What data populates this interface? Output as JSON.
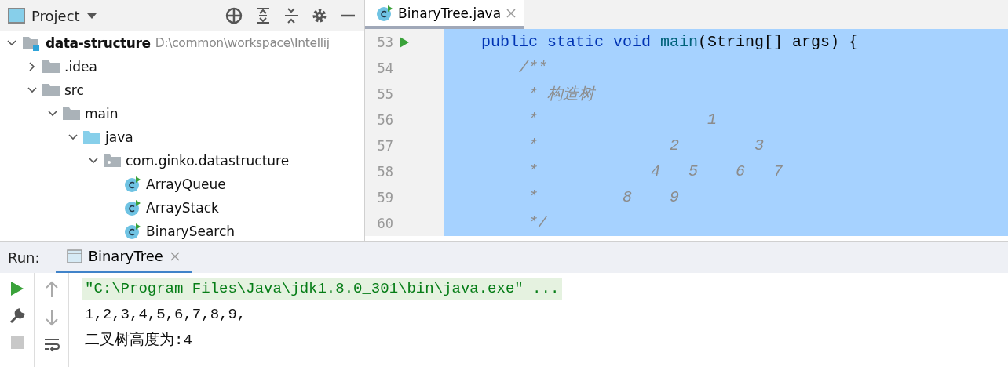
{
  "project_panel": {
    "title": "Project",
    "tree": [
      {
        "label": "data-structure",
        "hint": "D:\\common\\workspace\\Intellij",
        "kind": "module",
        "expanded": true,
        "children": [
          {
            "label": ".idea",
            "kind": "folder",
            "expanded": false
          },
          {
            "label": "src",
            "kind": "folder",
            "expanded": true,
            "children": [
              {
                "label": "main",
                "kind": "folder",
                "expanded": true,
                "children": [
                  {
                    "label": "java",
                    "kind": "source",
                    "expanded": true,
                    "children": [
                      {
                        "label": "com.ginko.datastructure",
                        "kind": "package",
                        "expanded": true,
                        "children": [
                          {
                            "label": "ArrayQueue",
                            "kind": "class"
                          },
                          {
                            "label": "ArrayStack",
                            "kind": "class"
                          },
                          {
                            "label": "BinarySearch",
                            "kind": "class"
                          }
                        ]
                      }
                    ]
                  }
                ]
              }
            ]
          }
        ]
      }
    ]
  },
  "editor": {
    "tabs": [
      {
        "label": "BinaryTree.java",
        "selected": true
      }
    ],
    "lines": [
      {
        "number": "53",
        "runnable": true,
        "tokens": [
          {
            "text": "    public static void ",
            "kind": "keyword"
          },
          {
            "text": "main",
            "kind": "method"
          },
          {
            "text": "(String[] args) {",
            "kind": "plain"
          }
        ]
      },
      {
        "number": "54",
        "runnable": false,
        "tokens": [
          {
            "text": "        /**",
            "kind": "comment"
          }
        ]
      },
      {
        "number": "55",
        "runnable": false,
        "tokens": [
          {
            "text": "         * 构造树",
            "kind": "comment"
          }
        ]
      },
      {
        "number": "56",
        "runnable": false,
        "tokens": [
          {
            "text": "         *                  1",
            "kind": "comment"
          }
        ]
      },
      {
        "number": "57",
        "runnable": false,
        "tokens": [
          {
            "text": "         *              2        3",
            "kind": "comment"
          }
        ]
      },
      {
        "number": "58",
        "runnable": false,
        "tokens": [
          {
            "text": "         *            4   5    6   7",
            "kind": "comment"
          }
        ]
      },
      {
        "number": "59",
        "runnable": false,
        "tokens": [
          {
            "text": "         *         8    9",
            "kind": "comment"
          }
        ]
      },
      {
        "number": "60",
        "runnable": false,
        "tokens": [
          {
            "text": "         */",
            "kind": "comment"
          }
        ]
      }
    ]
  },
  "run_panel": {
    "label": "Run:",
    "tabs": [
      {
        "label": "BinaryTree",
        "selected": true
      }
    ],
    "output": [
      {
        "text": "\"C:\\Program Files\\Java\\jdk1.8.0_301\\bin\\java.exe\" ...",
        "kind": "command"
      },
      {
        "text": "1,2,3,4,5,6,7,8,9,",
        "kind": "stdout"
      },
      {
        "text": "二叉树高度为:4",
        "kind": "stdout"
      }
    ]
  }
}
